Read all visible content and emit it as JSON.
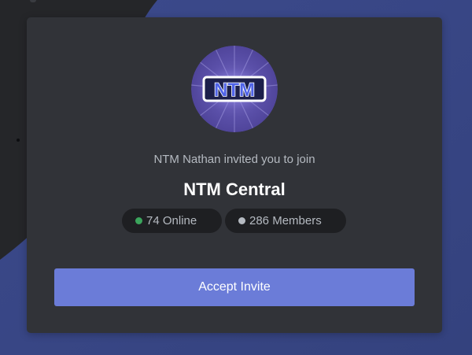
{
  "invite": {
    "inviter_text": "NTM Nathan invited you to join",
    "server_name": "NTM Central",
    "server_icon_text": "NTM",
    "online_label": "74 Online",
    "members_label": "286 Members",
    "accept_label": "Accept Invite"
  },
  "colors": {
    "online_dot": "#3ba55c",
    "members_dot": "#b5bac1",
    "accent": "#6b7cd8"
  },
  "icons": {
    "server_icon": "ntm-logo-icon",
    "online_indicator": "online-status-dot-icon",
    "members_indicator": "member-count-dot-icon"
  }
}
